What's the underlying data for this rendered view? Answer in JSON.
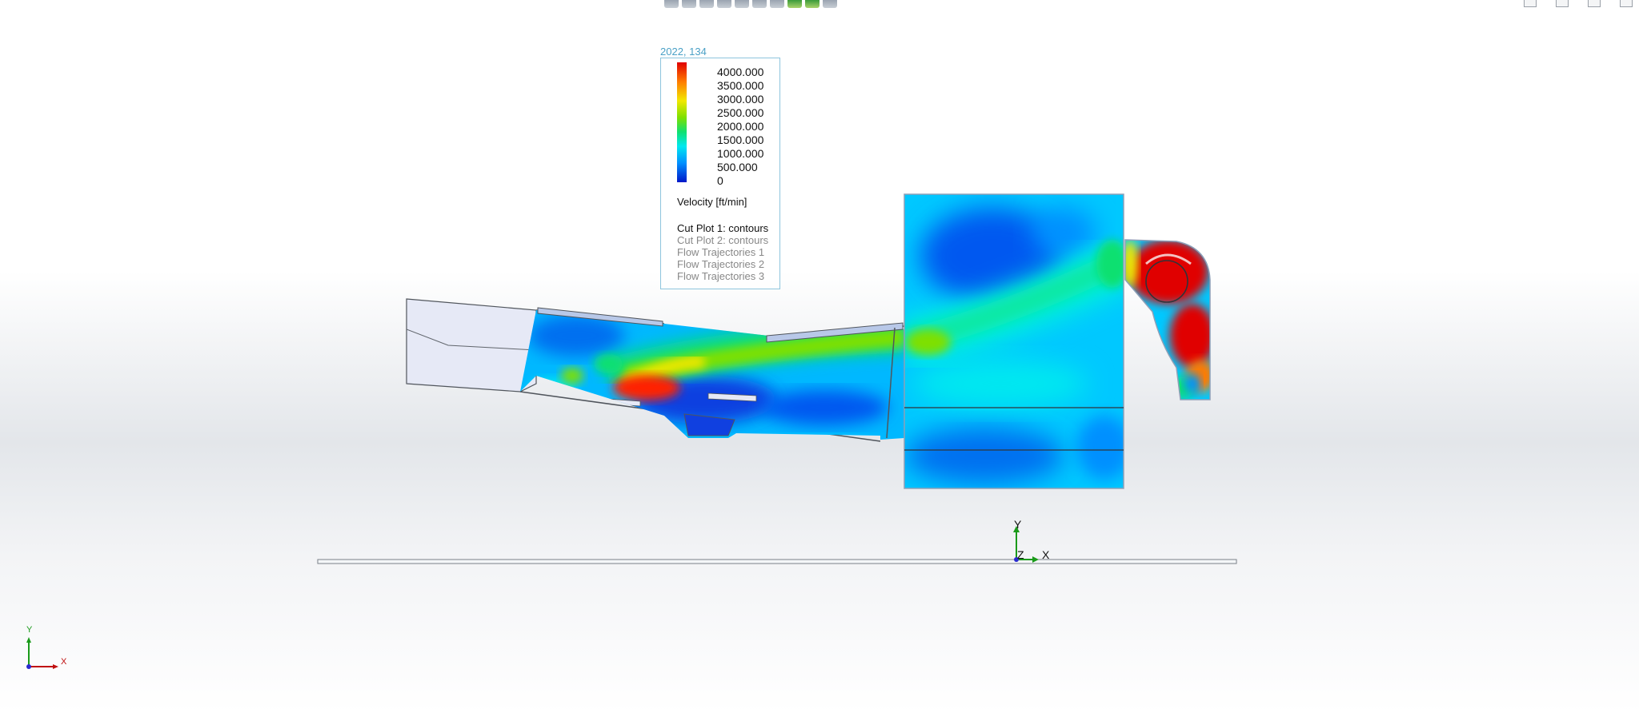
{
  "window": {
    "toolbar_icons": [
      "zoom-to-fit-icon",
      "zoom-area-icon",
      "previous-view-icon",
      "section-view-icon",
      "view-orientation-icon",
      "display-style-icon",
      "hide-show-icon",
      "edit-appearance-icon",
      "apply-scene-icon",
      "view-settings-icon"
    ],
    "window_controls": [
      "tile-icon",
      "restore-icon",
      "minimize-icon",
      "maximize-icon"
    ]
  },
  "legend": {
    "coordinate": "2022, 134",
    "ticks": [
      "4000.000",
      "3500.000",
      "3000.000",
      "2500.000",
      "2000.000",
      "1500.000",
      "1000.000",
      "500.000",
      "0"
    ],
    "quantity": "Velocity [ft/min]",
    "plots": [
      {
        "label": "Cut Plot 1: contours",
        "active": true
      },
      {
        "label": "Cut Plot 2: contours",
        "active": false
      },
      {
        "label": "Flow Trajectories 1",
        "active": false
      },
      {
        "label": "Flow Trajectories 2",
        "active": false
      },
      {
        "label": "Flow Trajectories 3",
        "active": false
      }
    ],
    "colors": [
      "#e00000",
      "#ff7a00",
      "#f2e800",
      "#7ee000",
      "#10e070",
      "#00e8f0",
      "#0090ff",
      "#0018c8"
    ]
  },
  "triad": {
    "x": "X",
    "y": "Y",
    "z": "Z"
  },
  "triad_small": {
    "x": "X",
    "y": "Y"
  }
}
